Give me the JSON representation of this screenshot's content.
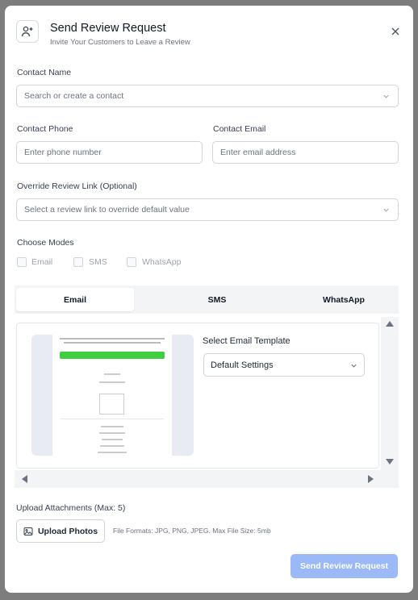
{
  "modal": {
    "title": "Send Review Request",
    "subtitle": "Invite Your Customers to Leave a Review"
  },
  "contact_name": {
    "label": "Contact Name",
    "placeholder": "Search or create a contact"
  },
  "contact_phone": {
    "label": "Contact Phone",
    "placeholder": "Enter phone number"
  },
  "contact_email": {
    "label": "Contact Email",
    "placeholder": "Enter email address"
  },
  "override_link": {
    "label": "Override Review Link (Optional)",
    "placeholder": "Select a review link to override default value"
  },
  "modes": {
    "label": "Choose Modes",
    "options": [
      {
        "label": "Email",
        "checked": false
      },
      {
        "label": "SMS",
        "checked": false
      },
      {
        "label": "WhatsApp",
        "checked": false
      }
    ]
  },
  "tabs": [
    {
      "label": "Email",
      "active": true
    },
    {
      "label": "SMS",
      "active": false
    },
    {
      "label": "WhatsApp",
      "active": false
    }
  ],
  "email_panel": {
    "template_label": "Select Email Template",
    "template_value": "Default Settings"
  },
  "upload": {
    "label": "Upload Attachments (Max: 5)",
    "button": "Upload Photos",
    "formats": "File Formats: JPG, PNG, JPEG. Max File Size: 5mb"
  },
  "submit_label": "Send Review Request",
  "colors": {
    "overlay": "#7d7d7d",
    "primary_disabled": "#9bb8f7",
    "preview_button": "#3fce3f"
  }
}
